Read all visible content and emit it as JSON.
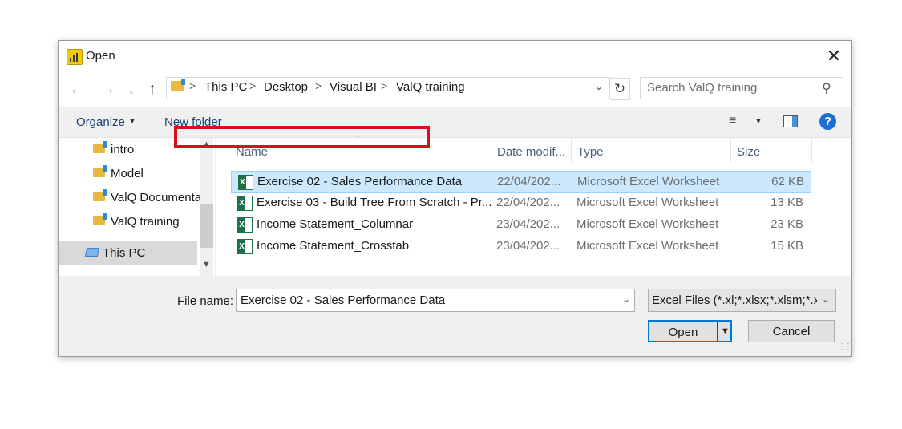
{
  "window": {
    "title": "Open",
    "close_glyph": "✕"
  },
  "nav": {
    "back_glyph": "←",
    "forward_glyph": "→",
    "recent_glyph": "⌄",
    "up_glyph": "↑",
    "breadcrumbs": [
      "This PC",
      "Desktop",
      "Visual BI",
      "ValQ training"
    ],
    "separator": ">",
    "refresh_glyph": "↻",
    "search_placeholder": "Search ValQ training",
    "search_glyph": "⚲"
  },
  "toolbar": {
    "organize_label": "Organize",
    "new_folder_label": "New folder",
    "help_glyph": "?"
  },
  "sidebar": {
    "items": [
      {
        "label": "intro",
        "icon": "folder-icon"
      },
      {
        "label": "Model",
        "icon": "folder-icon"
      },
      {
        "label": "ValQ Documenta",
        "icon": "folder-icon"
      },
      {
        "label": "ValQ training",
        "icon": "folder-icon"
      }
    ],
    "this_pc": {
      "label": "This PC",
      "icon": "computer-icon"
    }
  },
  "file_list": {
    "columns": [
      "Name",
      "Date modif...",
      "Type",
      "Size"
    ],
    "sorted_column": "Name",
    "rows": [
      {
        "name": "Exercise 02 - Sales Performance Data",
        "date": "22/04/202...",
        "type": "Microsoft Excel Worksheet",
        "size": "62 KB",
        "selected": true
      },
      {
        "name": "Exercise 03 - Build Tree From Scratch - Pr...",
        "date": "22/04/202...",
        "type": "Microsoft Excel Worksheet",
        "size": "13 KB",
        "selected": false
      },
      {
        "name": "Income Statement_Columnar",
        "date": "23/04/202...",
        "type": "Microsoft Excel Worksheet",
        "size": "23 KB",
        "selected": false
      },
      {
        "name": "Income Statement_Crosstab",
        "date": "23/04/202...",
        "type": "Microsoft Excel Worksheet",
        "size": "15 KB",
        "selected": false
      }
    ],
    "highlight_color": "#d8101e",
    "selection_color": "#cce8ff"
  },
  "footer": {
    "file_name_label": "File name:",
    "file_name_value": "Exercise 02 - Sales Performance Data",
    "file_type_value": "Excel Files (*.xl;*.xlsx;*.xlsm;*.xlsb",
    "open_label": "Open",
    "cancel_label": "Cancel"
  }
}
